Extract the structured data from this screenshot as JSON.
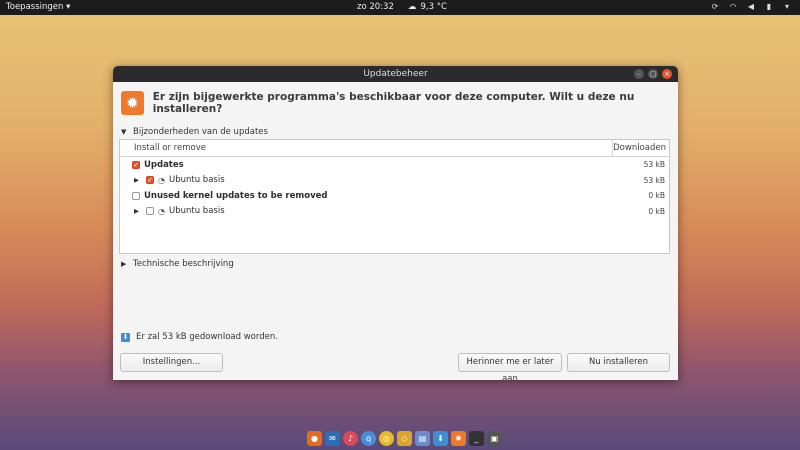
{
  "topbar": {
    "apps_label": "Toepassingen",
    "clock": "zo 20:32",
    "weather": "9,3 °C"
  },
  "window": {
    "title": "Updatebeheer",
    "heading": "Er zijn bijgewerkte programma's beschikbaar voor deze computer. Wilt u deze nu installeren?",
    "details_label": "Bijzonderheden van de updates",
    "columns": {
      "name": "Install or remove",
      "size": "Downloaden"
    },
    "rows": [
      {
        "label": "Updates",
        "size": "53 kB",
        "checked": true,
        "level": 0
      },
      {
        "label": "Ubuntu basis",
        "size": "53 kB",
        "checked": true,
        "level": 1
      },
      {
        "label": "Unused kernel updates to be removed",
        "size": "0 kB",
        "checked": false,
        "level": 0
      },
      {
        "label": "Ubuntu basis",
        "size": "0 kB",
        "checked": false,
        "level": 1
      }
    ],
    "tech_label": "Technische beschrijving",
    "download_info": "Er zal 53 kB gedownload worden.",
    "buttons": {
      "settings": "Instellingen...",
      "later": "Herinner me er later aan",
      "install": "Nu installeren"
    }
  },
  "colors": {
    "accent": "#e8552a",
    "app_icon": "#f07a2a"
  }
}
